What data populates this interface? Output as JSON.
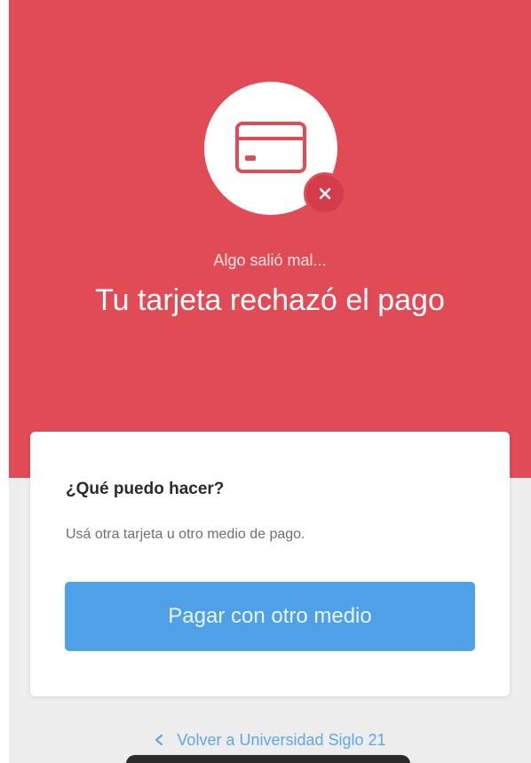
{
  "icons": {
    "main": "credit-card-icon",
    "badge": "close-icon",
    "back": "chevron-left-icon"
  },
  "hero": {
    "subtitle": "Algo salió mal...",
    "title": "Tu tarjeta rechazó el pago"
  },
  "panel": {
    "heading": "¿Qué puedo hacer?",
    "text": "Usá otra tarjeta u otro medio de pago.",
    "button_label": "Pagar con otro medio"
  },
  "footer": {
    "back_link": "Volver a Universidad Siglo 21"
  },
  "colors": {
    "hero_background": "#e04b55",
    "badge": "#d33c4a",
    "button": "#4ea1e6",
    "link": "#5fa7e6"
  }
}
